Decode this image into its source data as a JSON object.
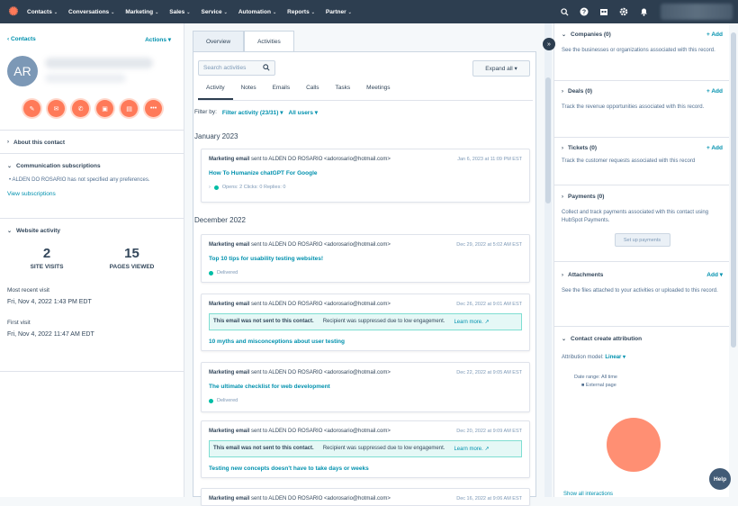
{
  "topnav": {
    "logo": "✺",
    "items": [
      {
        "label": "Contacts"
      },
      {
        "label": "Conversations"
      },
      {
        "label": "Marketing"
      },
      {
        "label": "Sales"
      },
      {
        "label": "Service"
      },
      {
        "label": "Automation"
      },
      {
        "label": "Reports"
      },
      {
        "label": "Partner"
      }
    ],
    "icons": [
      "search-icon",
      "help-icon",
      "marketplace-icon",
      "settings-icon",
      "notifications-icon"
    ]
  },
  "left": {
    "back_label": "‹ Contacts",
    "actions_label": "Actions ▾",
    "avatar_initials": "AR",
    "action_icons": [
      "✎",
      "✉",
      "✆",
      "▣",
      "▤",
      "•••"
    ],
    "about_title": "About this contact",
    "comm_title": "Communication subscriptions",
    "comm_text": "ALDEN DO ROSARIO has not specified any preferences.",
    "view_subscriptions": "View subscriptions",
    "website_title": "Website activity",
    "site_visits": "2",
    "site_visits_label": "SITE VISITS",
    "pages_viewed": "15",
    "pages_viewed_label": "PAGES VIEWED",
    "recent_visit_label": "Most recent visit",
    "recent_visit_value": "Fri, Nov 4, 2022 1:43 PM EDT",
    "first_visit_label": "First visit",
    "first_visit_value": "Fri, Nov 4, 2022 11:47 AM EDT"
  },
  "middle": {
    "tabs": [
      {
        "label": "Overview"
      },
      {
        "label": "Activities"
      }
    ],
    "search_placeholder": "Search activities",
    "expand_label": "Expand all ▾",
    "subtabs": [
      {
        "label": "Activity"
      },
      {
        "label": "Notes"
      },
      {
        "label": "Emails"
      },
      {
        "label": "Calls"
      },
      {
        "label": "Tasks"
      },
      {
        "label": "Meetings"
      }
    ],
    "filter_by": "Filter by:",
    "filter_activity": "Filter activity (23/31) ▾",
    "all_users": "All users ▾",
    "month1": "January 2023",
    "month2": "December 2022",
    "cards": [
      {
        "type": "Marketing email",
        "sent": "sent to ALDEN DO ROSARIO <adorosario@hotmail.com>",
        "date": "Jan 6, 2023 at 11:09 PM EST",
        "subject": "How To Humanize chatGPT For Google",
        "status": "Opens: 2   Clicks: 0   Replies: 0"
      },
      {
        "type": "Marketing email",
        "sent": "sent to ALDEN DO ROSARIO <adorosario@hotmail.com>",
        "date": "Dec 29, 2022 at 5:02 AM EST",
        "subject": "Top 10 tips for usability testing websites!",
        "status": "Delivered"
      },
      {
        "type": "Marketing email",
        "sent": "sent to ALDEN DO ROSARIO <adorosario@hotmail.com>",
        "date": "Dec 26, 2022 at 9:01 AM EST",
        "warn_bold": "This email was not sent to this contact.",
        "warn_text": "Recipient was suppressed due to low engagement.",
        "warn_link": "Learn more. ↗",
        "subject": "10 myths and misconceptions about user testing"
      },
      {
        "type": "Marketing email",
        "sent": "sent to ALDEN DO ROSARIO <adorosario@hotmail.com>",
        "date": "Dec 22, 2022 at 9:05 AM EST",
        "subject": "The ultimate checklist for web development",
        "status": "Delivered"
      },
      {
        "type": "Marketing email",
        "sent": "sent to ALDEN DO ROSARIO <adorosario@hotmail.com>",
        "date": "Dec 20, 2022 at 9:09 AM EST",
        "warn_bold": "This email was not sent to this contact.",
        "warn_text": "Recipient was suppressed due to low engagement.",
        "warn_link": "Learn more. ↗",
        "subject": "Testing new concepts doesn't have to take days or weeks"
      },
      {
        "type": "Marketing email",
        "sent": "sent to ALDEN DO ROSARIO <adorosario@hotmail.com>",
        "date": "Dec 16, 2022 at 9:06 AM EST"
      }
    ]
  },
  "right": {
    "companies": {
      "title": "Companies (0)",
      "add": "+ Add",
      "desc": "See the businesses or organizations associated with this record."
    },
    "deals": {
      "title": "Deals (0)",
      "add": "+ Add",
      "desc": "Track the revenue opportunities associated with this record."
    },
    "tickets": {
      "title": "Tickets (0)",
      "add": "+ Add",
      "desc": "Track the customer requests associated with this record"
    },
    "payments": {
      "title": "Payments (0)",
      "desc": "Collect and track payments associated with this contact using HubSpot Payments.",
      "button": "Set up payments"
    },
    "attachments": {
      "title": "Attachments",
      "add": "Add ▾",
      "desc": "See the files attached to your activities or uploaded to this record."
    },
    "attribution": {
      "title": "Contact create attribution",
      "model_label": "Attribution model:",
      "model_value": "Linear ▾",
      "date_range": "Date range: All time",
      "legend": "External page"
    },
    "show_all": "Show all interactions"
  },
  "help_label": "Help",
  "colors": {
    "nav": "#2d3e50",
    "accent": "#ff7a59",
    "link": "#0091ae"
  }
}
